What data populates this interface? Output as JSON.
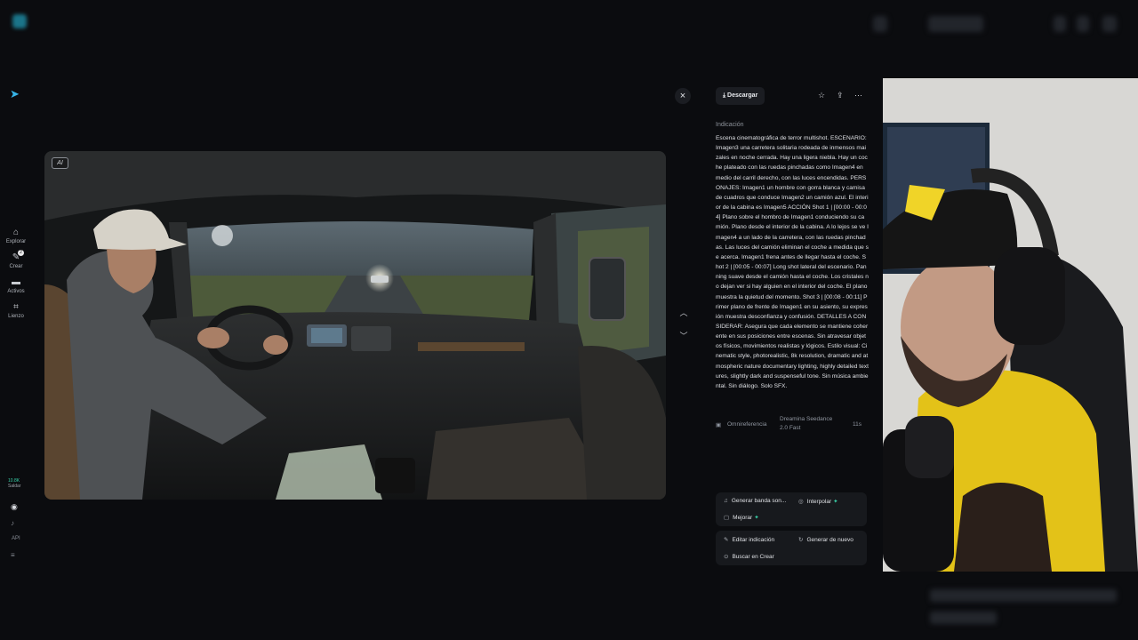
{
  "rail": {
    "items": [
      {
        "label": "Explorar",
        "icon": "home-icon"
      },
      {
        "label": "Crear",
        "icon": "create-icon",
        "badge": "2"
      },
      {
        "label": "Activos",
        "icon": "folder-icon"
      },
      {
        "label": "Lienzo",
        "icon": "canvas-icon"
      }
    ],
    "credits_value": "10.8K",
    "credits_label": "Saldar",
    "api_label": "API"
  },
  "viewer": {
    "ai_badge": "AI",
    "close_icon": "×"
  },
  "panel": {
    "download_label": "Descargar",
    "prompt_label": "Indicación",
    "prompt_text": "Escena cinematográfica de terror multishot. ESCENARIO: Imagen3 una carretera solitaria rodeada de inmensos maizales en noche cerrada. Hay una ligera niebla. Hay un coche plateado con las ruedas pinchadas como Imagen4 en medio del carril derecho, con las luces encendidas. PERSONAJES: Imagen1 un hombre con gorra blanca y camisa de cuadros que conduce Imagen2 un camión azul. El interior de la cabina es Imagen5 ACCIÓN Shot 1 | [00:00 - 00:04] Plano sobre el hombro de Imagen1 conduciendo su camión. Plano desde el interior de la cabina. A lo lejos se ve Imagen4 a un lado de la carretera, con las ruedas pinchadas. Las luces del camión eliminan el coche a medida que se acerca. Imagen1 frena antes de llegar hasta el coche. Shot 2 | [00:05 - 00:07] Long shot lateral del escenario. Panning suave desde el camión hasta el coche. Los cristales no dejan ver si hay alguien en el interior del coche. El plano muestra la quietud del momento. Shot 3 | [00:08 - 00:11] Primer plano de frente de Imagen1 en su asiento, su expresión muestra desconfianza y confusión. DETALLES A CONSIDERAR: Asegura que cada elemento se mantiene coherente en sus posiciones entre escenas. Sin atravesar objetos físicos, movimientos realistas y lógicos. Estilo visual: Cinematic style, photorealistic, 8k resolution, dramatic and atmospheric nature documentary lighting, highly detailed textures, slightly dark and suspenseful tone. Sin música ambiental. Sin diálogo. Solo SFX.",
    "meta_mode": "Omnireferencia",
    "meta_model_line1": "Dreamina Seedance",
    "meta_model_line2": "2.0 Fast",
    "meta_duration": "11s"
  },
  "actions_top": [
    {
      "label": "Generar banda son...",
      "icon": "music-icon",
      "plus": false
    },
    {
      "label": "Interpolar",
      "icon": "interpolate-icon",
      "plus": true
    },
    {
      "label": "Mejorar",
      "icon": "enhance-icon",
      "plus": true
    }
  ],
  "actions_bottom": [
    {
      "label": "Editar indicación",
      "icon": "edit-icon"
    },
    {
      "label": "Generar de nuevo",
      "icon": "refresh-icon"
    },
    {
      "label": "Buscar en Crear",
      "icon": "search-icon"
    }
  ],
  "colors": {
    "accent": "#39d0a8",
    "brand": "#37b5e8",
    "background": "#0b0c0f"
  }
}
